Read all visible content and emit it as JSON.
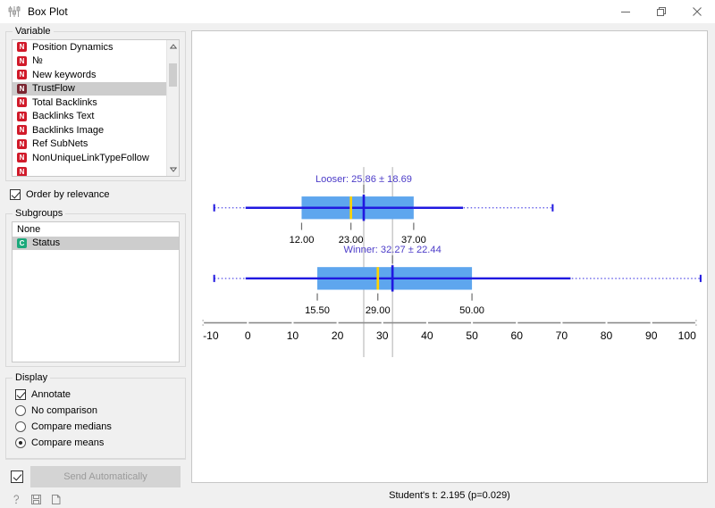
{
  "window": {
    "title": "Box Plot",
    "app_icon": "boxplot-icon",
    "minimize_label": "Minimize",
    "maximize_label": "Maximize",
    "close_label": "Close"
  },
  "sidebar": {
    "variable_group": {
      "title": "Variable",
      "items": [
        {
          "label": "Position Dynamics",
          "icon": "numeric-variable-icon",
          "selected": false
        },
        {
          "label": "№",
          "icon": "numeric-variable-icon",
          "selected": false
        },
        {
          "label": "New keywords",
          "icon": "numeric-variable-icon",
          "selected": false
        },
        {
          "label": "TrustFlow",
          "icon": "numeric-variable-icon",
          "selected": true
        },
        {
          "label": "Total Backlinks",
          "icon": "numeric-variable-icon",
          "selected": false
        },
        {
          "label": "Backlinks Text",
          "icon": "numeric-variable-icon",
          "selected": false
        },
        {
          "label": "Backlinks Image",
          "icon": "numeric-variable-icon",
          "selected": false
        },
        {
          "label": "Ref SubNets",
          "icon": "numeric-variable-icon",
          "selected": false
        },
        {
          "label": "NonUniqueLinkTypeFollow",
          "icon": "numeric-variable-icon",
          "selected": false
        }
      ],
      "order_by_relevance": {
        "label": "Order by relevance",
        "checked": true
      }
    },
    "subgroups_group": {
      "title": "Subgroups",
      "items": [
        {
          "label": "None",
          "icon": "none-icon",
          "selected": false
        },
        {
          "label": "Status",
          "icon": "categorical-variable-icon",
          "selected": true
        }
      ]
    },
    "display_group": {
      "title": "Display",
      "annotate": {
        "label": "Annotate",
        "checked": true
      },
      "comparison_options": [
        {
          "label": "No comparison",
          "selected": false
        },
        {
          "label": "Compare medians",
          "selected": false
        },
        {
          "label": "Compare means",
          "selected": true
        }
      ]
    },
    "send": {
      "checkbox_checked": true,
      "button_label": "Send Automatically"
    },
    "status_icons": [
      {
        "name": "help-icon",
        "glyph": "?"
      },
      {
        "name": "save-icon",
        "glyph": "💾"
      },
      {
        "name": "report-icon",
        "glyph": "📄"
      }
    ]
  },
  "statusbar": {
    "text": "Student's t: 2.195 (p=0.029)"
  },
  "chart_data": {
    "type": "box",
    "title": "",
    "xlabel": "",
    "ylabel": "",
    "xlim": [
      -10,
      100
    ],
    "xticks": [
      -10,
      0,
      10,
      20,
      30,
      40,
      50,
      60,
      70,
      80,
      90,
      100
    ],
    "xticklabels": [
      "-10",
      "0",
      "10",
      "20",
      "30",
      "40",
      "50",
      "60",
      "70",
      "80",
      "90",
      "100"
    ],
    "grid": false,
    "legend": "none",
    "comparison_lines": [
      25.86,
      32.27
    ],
    "colors": {
      "box_fill": "#5ea6ee",
      "whisker": "#2018e0",
      "median": "#ffd400",
      "mean_marker": "#2018e0",
      "annotation_text": "#4b3bc8",
      "axis": "#8c8c8c",
      "comparison_line": "#b0b0b0"
    },
    "boxes": [
      {
        "group": "Looser",
        "label": "Looser: 25.86 ± 18.69",
        "mean": 25.86,
        "sd": 18.69,
        "q1": 12.0,
        "median": 23.0,
        "q3": 37.0,
        "q1_label": "12.00",
        "median_label": "23.00",
        "q3_label": "37.00",
        "whisker_low": -0.5,
        "whisker_high": 48.0,
        "range_low": -7.5,
        "range_high": 68.0
      },
      {
        "group": "Winner",
        "label": "Winner: 32.27 ± 22.44",
        "mean": 32.27,
        "sd": 22.44,
        "q1": 15.5,
        "median": 29.0,
        "q3": 50.0,
        "q1_label": "15.50",
        "median_label": "29.00",
        "q3_label": "50.00",
        "whisker_low": -0.5,
        "whisker_high": 72.0,
        "range_low": -7.5,
        "range_high": 101.0
      }
    ]
  }
}
